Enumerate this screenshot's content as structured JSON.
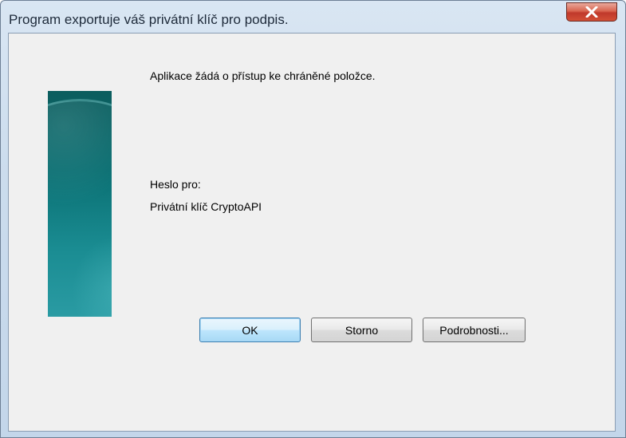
{
  "window": {
    "title": "Program exportuje váš privátní klíč pro podpis.",
    "close_icon": "close-x-icon"
  },
  "dialog": {
    "message": "Aplikace žádá o přístup ke chráněné položce.",
    "password_for_label": "Heslo pro:",
    "item_name": "Privátní klíč CryptoAPI",
    "banner_image": "security-banner"
  },
  "buttons": {
    "ok": "OK",
    "cancel": "Storno",
    "details": "Podrobnosti..."
  },
  "colors": {
    "close_button": "#c0392b",
    "banner": "#0a6f72",
    "default_button_border": "#3c7fb1"
  }
}
